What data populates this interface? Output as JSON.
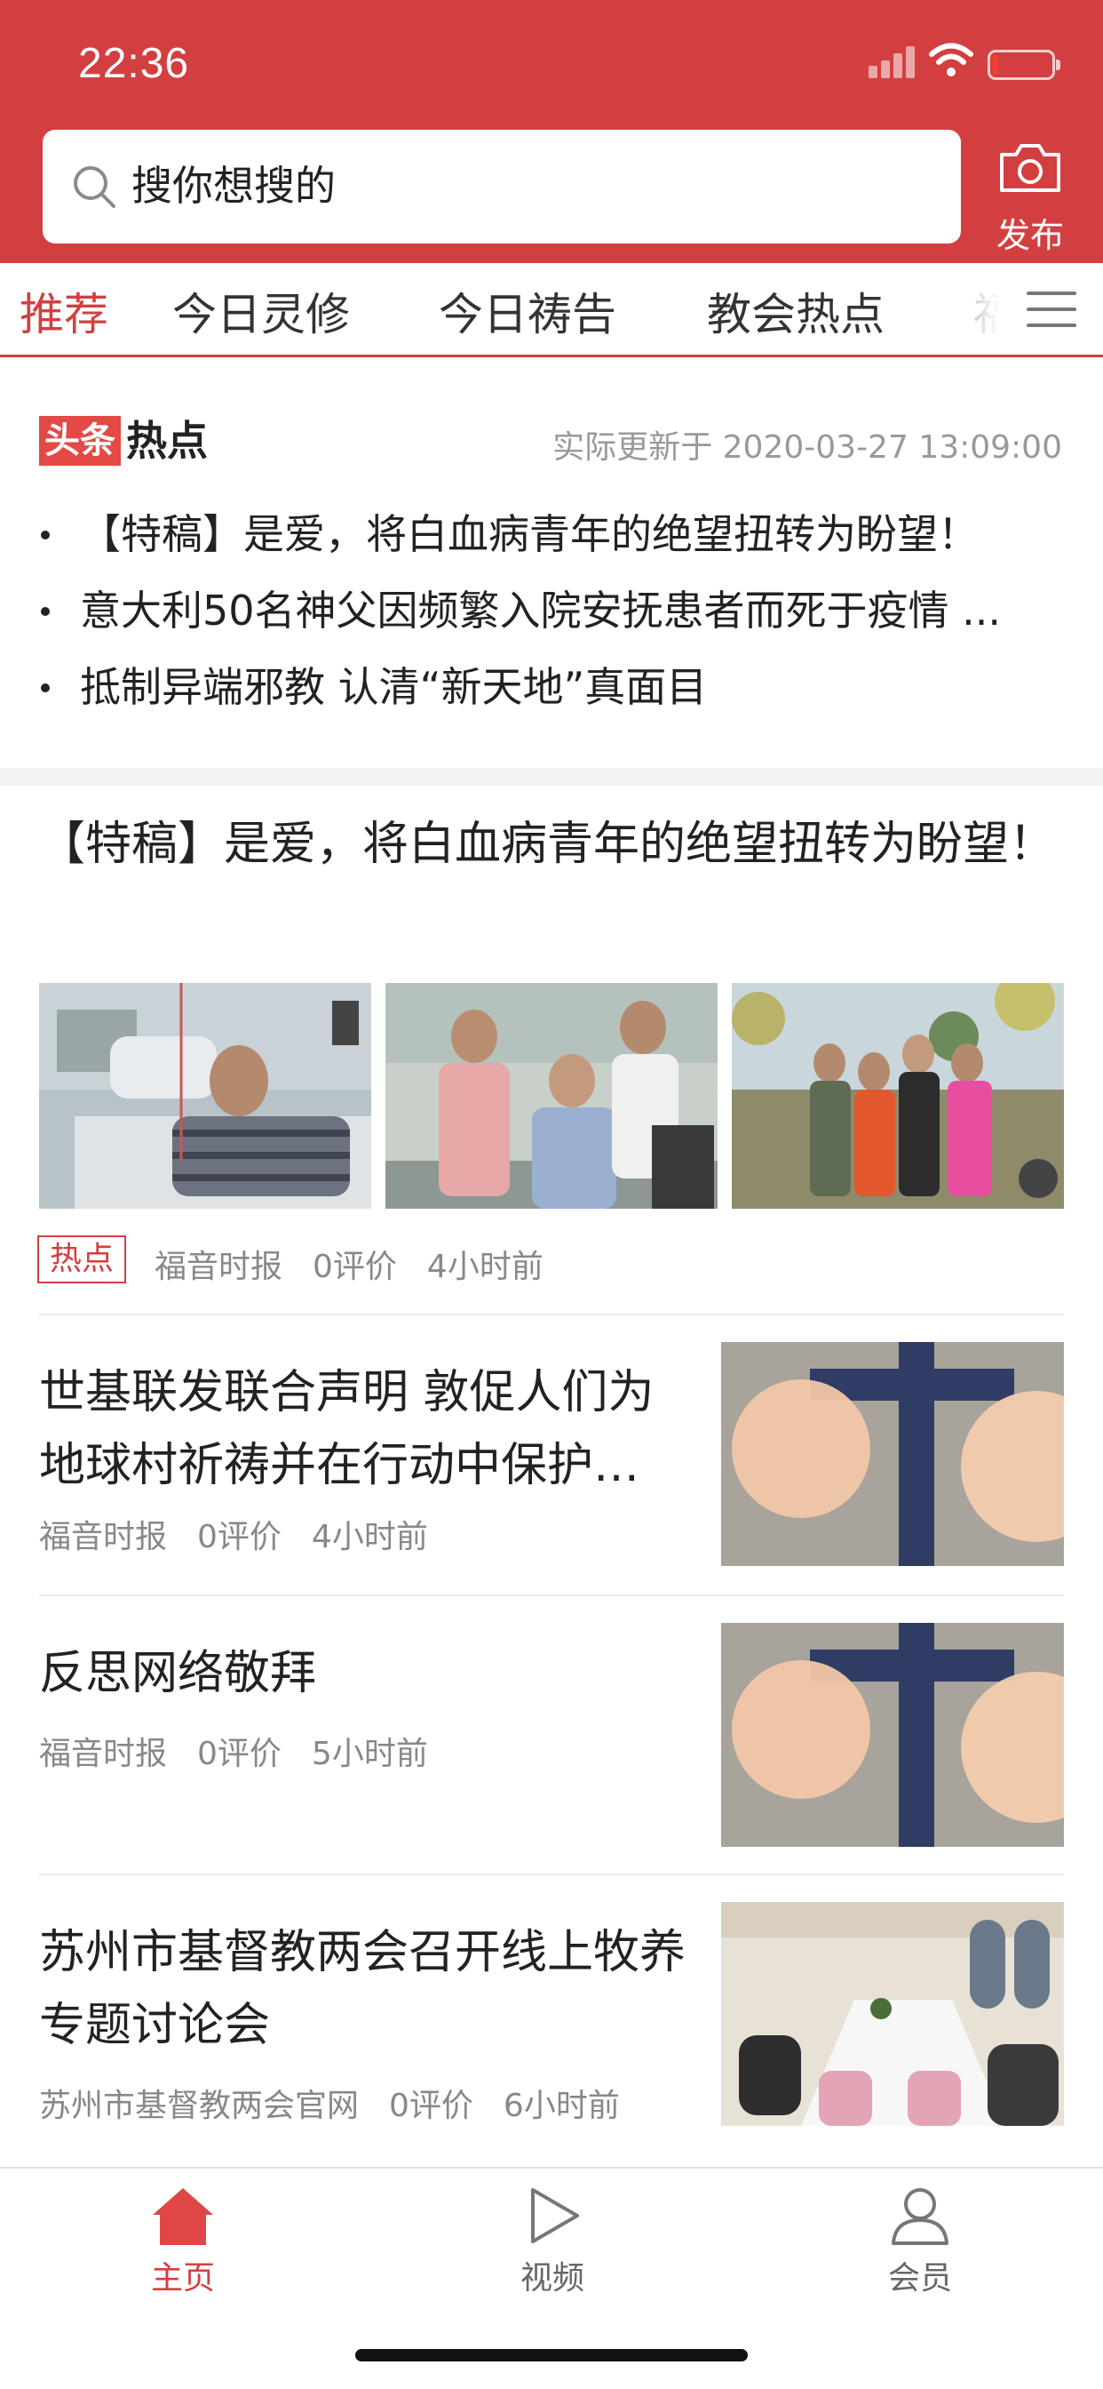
{
  "status_bar": {
    "time": "22:36"
  },
  "search": {
    "placeholder": "搜你想搜的"
  },
  "publish": {
    "label": "发布"
  },
  "tabs": [
    {
      "label": "推荐",
      "active": true
    },
    {
      "label": "今日灵修"
    },
    {
      "label": "今日祷告"
    },
    {
      "label": "教会热点"
    },
    {
      "label": "福"
    }
  ],
  "headline": {
    "logo_box": "头条",
    "logo_text": "热点",
    "update_time": "实际更新于 2020-03-27 13:09:00",
    "items": [
      "【特稿】是爱，将白血病青年的绝望扭转为盼望！",
      "意大利50名神父因频繁入院安抚患者而死于疫情 ...",
      "抵制异端邪教 认清“新天地”真面目"
    ]
  },
  "feature": {
    "title": "【特稿】是爱，将白血病青年的绝望扭转为盼望！",
    "tag": "热点",
    "source": "福音时报",
    "comments": "0评价",
    "time": "4小时前"
  },
  "news": [
    {
      "title": "世基联发联合声明 敦促人们为地球村祈祷并在行动中保护…",
      "source": "福音时报",
      "comments": "0评价",
      "time": "4小时前"
    },
    {
      "title": "反思网络敬拜",
      "source": "福音时报",
      "comments": "0评价",
      "time": "5小时前"
    },
    {
      "title": "苏州市基督教两会召开线上牧养专题讨论会",
      "source": "苏州市基督教两会官网",
      "comments": "0评价",
      "time": "6小时前"
    }
  ],
  "bottom_nav": [
    {
      "label": "主页",
      "icon": "home-icon",
      "active": true
    },
    {
      "label": "视频",
      "icon": "play-icon"
    },
    {
      "label": "会员",
      "icon": "user-icon"
    }
  ],
  "colors": {
    "brand_red": "#d33f40",
    "meta_gray": "#888888",
    "bg_separator": "#f2f2f2"
  }
}
